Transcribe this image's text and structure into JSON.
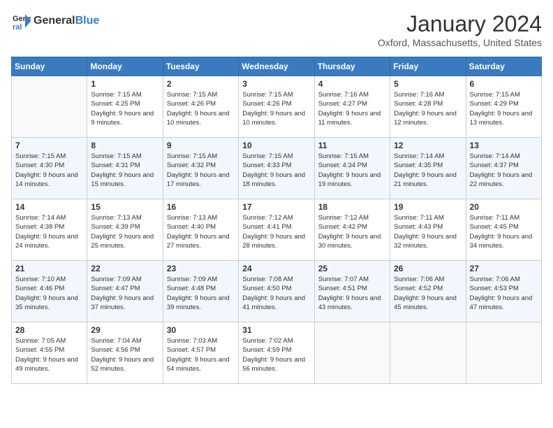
{
  "header": {
    "logo_general": "General",
    "logo_blue": "Blue",
    "month_title": "January 2024",
    "location": "Oxford, Massachusetts, United States"
  },
  "days_of_week": [
    "Sunday",
    "Monday",
    "Tuesday",
    "Wednesday",
    "Thursday",
    "Friday",
    "Saturday"
  ],
  "weeks": [
    [
      {
        "day": "",
        "sunrise": "",
        "sunset": "",
        "daylight": ""
      },
      {
        "day": "1",
        "sunrise": "Sunrise: 7:15 AM",
        "sunset": "Sunset: 4:25 PM",
        "daylight": "Daylight: 9 hours and 9 minutes."
      },
      {
        "day": "2",
        "sunrise": "Sunrise: 7:15 AM",
        "sunset": "Sunset: 4:26 PM",
        "daylight": "Daylight: 9 hours and 10 minutes."
      },
      {
        "day": "3",
        "sunrise": "Sunrise: 7:15 AM",
        "sunset": "Sunset: 4:26 PM",
        "daylight": "Daylight: 9 hours and 10 minutes."
      },
      {
        "day": "4",
        "sunrise": "Sunrise: 7:16 AM",
        "sunset": "Sunset: 4:27 PM",
        "daylight": "Daylight: 9 hours and 11 minutes."
      },
      {
        "day": "5",
        "sunrise": "Sunrise: 7:16 AM",
        "sunset": "Sunset: 4:28 PM",
        "daylight": "Daylight: 9 hours and 12 minutes."
      },
      {
        "day": "6",
        "sunrise": "Sunrise: 7:15 AM",
        "sunset": "Sunset: 4:29 PM",
        "daylight": "Daylight: 9 hours and 13 minutes."
      }
    ],
    [
      {
        "day": "7",
        "sunrise": "Sunrise: 7:15 AM",
        "sunset": "Sunset: 4:30 PM",
        "daylight": "Daylight: 9 hours and 14 minutes."
      },
      {
        "day": "8",
        "sunrise": "Sunrise: 7:15 AM",
        "sunset": "Sunset: 4:31 PM",
        "daylight": "Daylight: 9 hours and 15 minutes."
      },
      {
        "day": "9",
        "sunrise": "Sunrise: 7:15 AM",
        "sunset": "Sunset: 4:32 PM",
        "daylight": "Daylight: 9 hours and 17 minutes."
      },
      {
        "day": "10",
        "sunrise": "Sunrise: 7:15 AM",
        "sunset": "Sunset: 4:33 PM",
        "daylight": "Daylight: 9 hours and 18 minutes."
      },
      {
        "day": "11",
        "sunrise": "Sunrise: 7:15 AM",
        "sunset": "Sunset: 4:34 PM",
        "daylight": "Daylight: 9 hours and 19 minutes."
      },
      {
        "day": "12",
        "sunrise": "Sunrise: 7:14 AM",
        "sunset": "Sunset: 4:35 PM",
        "daylight": "Daylight: 9 hours and 21 minutes."
      },
      {
        "day": "13",
        "sunrise": "Sunrise: 7:14 AM",
        "sunset": "Sunset: 4:37 PM",
        "daylight": "Daylight: 9 hours and 22 minutes."
      }
    ],
    [
      {
        "day": "14",
        "sunrise": "Sunrise: 7:14 AM",
        "sunset": "Sunset: 4:38 PM",
        "daylight": "Daylight: 9 hours and 24 minutes."
      },
      {
        "day": "15",
        "sunrise": "Sunrise: 7:13 AM",
        "sunset": "Sunset: 4:39 PM",
        "daylight": "Daylight: 9 hours and 25 minutes."
      },
      {
        "day": "16",
        "sunrise": "Sunrise: 7:13 AM",
        "sunset": "Sunset: 4:40 PM",
        "daylight": "Daylight: 9 hours and 27 minutes."
      },
      {
        "day": "17",
        "sunrise": "Sunrise: 7:12 AM",
        "sunset": "Sunset: 4:41 PM",
        "daylight": "Daylight: 9 hours and 28 minutes."
      },
      {
        "day": "18",
        "sunrise": "Sunrise: 7:12 AM",
        "sunset": "Sunset: 4:42 PM",
        "daylight": "Daylight: 9 hours and 30 minutes."
      },
      {
        "day": "19",
        "sunrise": "Sunrise: 7:11 AM",
        "sunset": "Sunset: 4:43 PM",
        "daylight": "Daylight: 9 hours and 32 minutes."
      },
      {
        "day": "20",
        "sunrise": "Sunrise: 7:11 AM",
        "sunset": "Sunset: 4:45 PM",
        "daylight": "Daylight: 9 hours and 34 minutes."
      }
    ],
    [
      {
        "day": "21",
        "sunrise": "Sunrise: 7:10 AM",
        "sunset": "Sunset: 4:46 PM",
        "daylight": "Daylight: 9 hours and 35 minutes."
      },
      {
        "day": "22",
        "sunrise": "Sunrise: 7:09 AM",
        "sunset": "Sunset: 4:47 PM",
        "daylight": "Daylight: 9 hours and 37 minutes."
      },
      {
        "day": "23",
        "sunrise": "Sunrise: 7:09 AM",
        "sunset": "Sunset: 4:48 PM",
        "daylight": "Daylight: 9 hours and 39 minutes."
      },
      {
        "day": "24",
        "sunrise": "Sunrise: 7:08 AM",
        "sunset": "Sunset: 4:50 PM",
        "daylight": "Daylight: 9 hours and 41 minutes."
      },
      {
        "day": "25",
        "sunrise": "Sunrise: 7:07 AM",
        "sunset": "Sunset: 4:51 PM",
        "daylight": "Daylight: 9 hours and 43 minutes."
      },
      {
        "day": "26",
        "sunrise": "Sunrise: 7:06 AM",
        "sunset": "Sunset: 4:52 PM",
        "daylight": "Daylight: 9 hours and 45 minutes."
      },
      {
        "day": "27",
        "sunrise": "Sunrise: 7:06 AM",
        "sunset": "Sunset: 4:53 PM",
        "daylight": "Daylight: 9 hours and 47 minutes."
      }
    ],
    [
      {
        "day": "28",
        "sunrise": "Sunrise: 7:05 AM",
        "sunset": "Sunset: 4:55 PM",
        "daylight": "Daylight: 9 hours and 49 minutes."
      },
      {
        "day": "29",
        "sunrise": "Sunrise: 7:04 AM",
        "sunset": "Sunset: 4:56 PM",
        "daylight": "Daylight: 9 hours and 52 minutes."
      },
      {
        "day": "30",
        "sunrise": "Sunrise: 7:03 AM",
        "sunset": "Sunset: 4:57 PM",
        "daylight": "Daylight: 9 hours and 54 minutes."
      },
      {
        "day": "31",
        "sunrise": "Sunrise: 7:02 AM",
        "sunset": "Sunset: 4:59 PM",
        "daylight": "Daylight: 9 hours and 56 minutes."
      },
      {
        "day": "",
        "sunrise": "",
        "sunset": "",
        "daylight": ""
      },
      {
        "day": "",
        "sunrise": "",
        "sunset": "",
        "daylight": ""
      },
      {
        "day": "",
        "sunrise": "",
        "sunset": "",
        "daylight": ""
      }
    ]
  ]
}
